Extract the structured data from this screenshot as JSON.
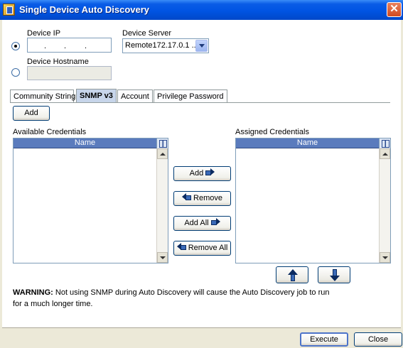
{
  "window": {
    "title": "Single Device Auto Discovery",
    "close": "✕"
  },
  "device": {
    "ip_label": "Device IP",
    "ip_dots": [
      ".",
      ".",
      "."
    ],
    "server_label": "Device Server",
    "server_value": "Remote172.17.0.1 ...",
    "hostname_label": "Device Hostname"
  },
  "tabs": [
    "Community String",
    "SNMP v3",
    "Account",
    "Privilege Password"
  ],
  "active_tab": "SNMP v3",
  "add_label": "Add",
  "available": {
    "label": "Available Credentials",
    "column": "Name"
  },
  "assigned": {
    "label": "Assigned Credentials",
    "column": "Name"
  },
  "transfer": {
    "add": "Add",
    "remove": "Remove",
    "add_all": "Add All",
    "remove_all": "Remove All"
  },
  "warning": {
    "prefix": "WARNING:",
    "text": " Not using SNMP during Auto Discovery will cause the Auto Discovery job to run for a much longer time."
  },
  "footer": {
    "execute": "Execute",
    "close": "Close"
  },
  "colors": {
    "titlebar": "#0054e3",
    "list_header": "#5a7bbd",
    "tab_active": "#c7d5ea"
  }
}
